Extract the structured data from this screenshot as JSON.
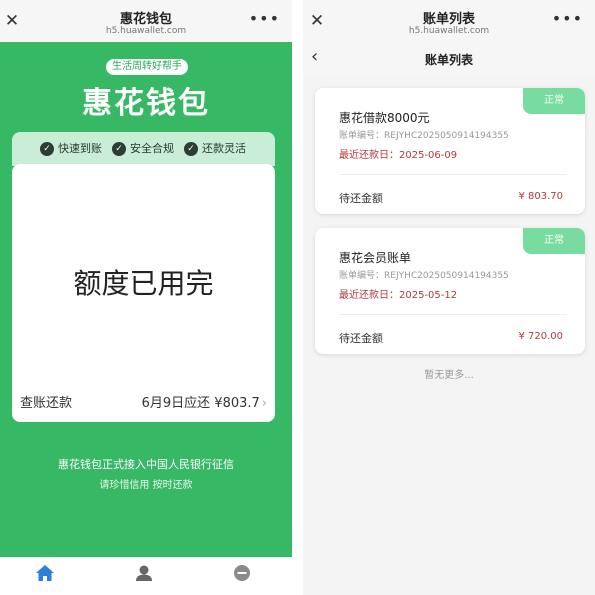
{
  "left": {
    "topbar": {
      "title": "惠花钱包",
      "subtitle": "h5.huawallet.com",
      "close": "✕",
      "more": "•••"
    },
    "slogan": "生活周转好帮手",
    "brand": "惠花钱包",
    "features": [
      "快速到账",
      "安全合规",
      "还款灵活"
    ],
    "card": {
      "quota_text": "额度已用完",
      "bill_link": "查账还款",
      "due_text": "6月9日应还 ¥803.7",
      "arrow": "›"
    },
    "notice_main": "惠花钱包正式接入中国人民银行征信",
    "notice_sub": "请珍惜信用 按时还款",
    "tabbar": {
      "items": [
        "home-icon",
        "profile-icon",
        "more-icon"
      ]
    },
    "colors": {
      "brand_green": "#37b865",
      "feature_bar": "#c9edd6",
      "tab_active": "#2f7fd8"
    }
  },
  "right": {
    "topbar": {
      "title": "账单列表",
      "subtitle": "h5.huawallet.com",
      "close": "✕",
      "more": "•••"
    },
    "nav": {
      "back": "‹",
      "title": "账单列表"
    },
    "bills": [
      {
        "status": "正常",
        "title": "惠花借款8000元",
        "number_label": "账单编号：",
        "number": "REJYHC2025050914194355",
        "due_label": "最近还款日：",
        "due_date": "2025-06-09",
        "amount_label": "待还金额",
        "amount": "¥ 803.70"
      },
      {
        "status": "正常",
        "title": "惠花会员账单",
        "number_label": "账单编号：",
        "number": "REJYHC2025050914194355",
        "due_label": "最近还款日：",
        "due_date": "2025-05-12",
        "amount_label": "待还金额",
        "amount": "¥ 720.00"
      }
    ],
    "no_more": "暂无更多...",
    "colors": {
      "status_badge": "#78dca0",
      "due_red": "#b33a3a"
    }
  }
}
